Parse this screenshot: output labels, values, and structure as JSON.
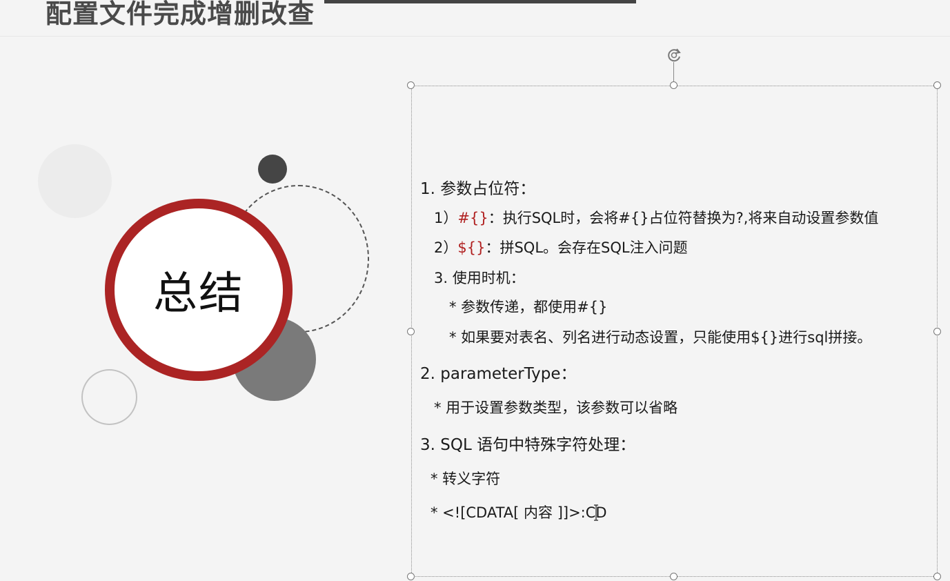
{
  "title": "配置文件完成增删改查",
  "graphic": {
    "label": "总结"
  },
  "summary": {
    "s1_heading": "1. 参数占位符：",
    "s1_item1_prefix": "1）",
    "s1_item1_token": "#{}",
    "s1_item1_text": "：执行SQL时，会将#{}占位符替换为?,将来自动设置参数值",
    "s1_item2_prefix": "2）",
    "s1_item2_token": "${}",
    "s1_item2_text": "：拼SQL。会存在SQL注入问题",
    "s1_item3": "3. 使用时机：",
    "s1_item3_a": "* 参数传递，都使用#{}",
    "s1_item3_b": "* 如果要对表名、列名进行动态设置，只能使用${}进行sql拼接。",
    "s2_heading": "2. parameterType：",
    "s2_item": "* 用于设置参数类型，该参数可以省略",
    "s3_heading": "3. SQL 语句中特殊字符处理：",
    "s3_item1": "* 转义字符",
    "s3_item2": "*  <![CDATA[ 内容 ]]>:CD"
  },
  "colors": {
    "accent_red": "#ab2424",
    "token_red": "#b02020"
  },
  "icons": {
    "rotate": "rotate-handle-icon",
    "cursor": "text-cursor-icon"
  }
}
